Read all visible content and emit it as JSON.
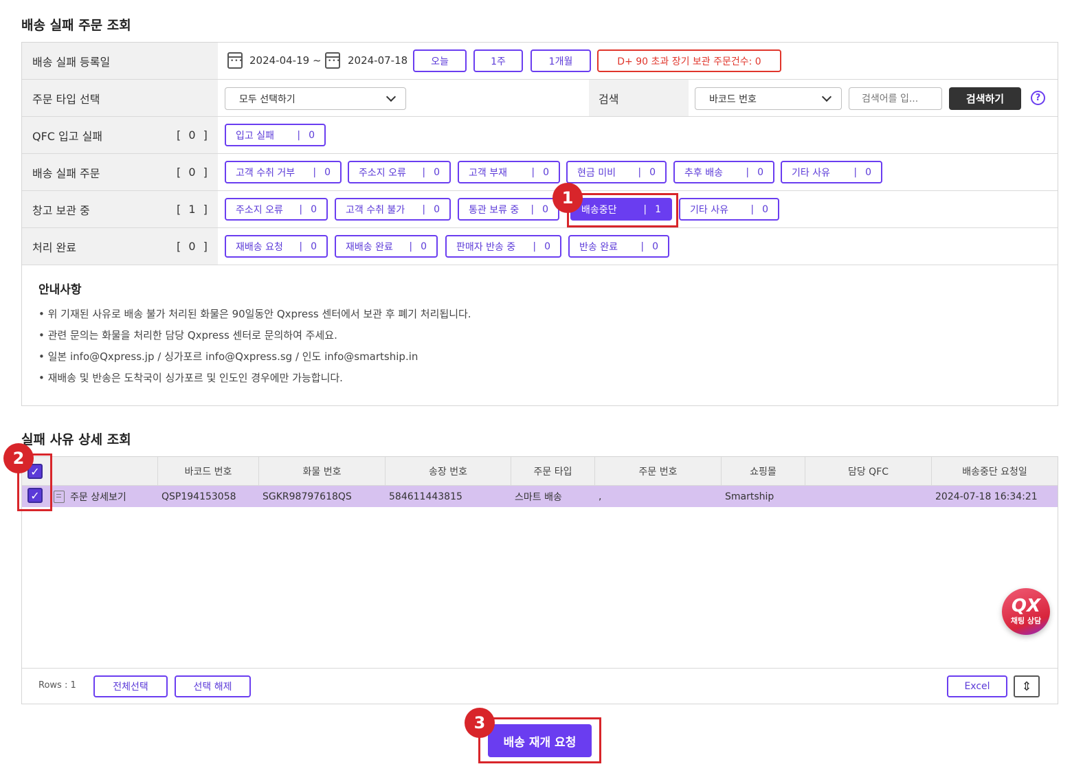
{
  "sections": {
    "search_title": "배송 실패 주문 조회",
    "detail_title": "실패 사유 상세 조회"
  },
  "filters": {
    "date": {
      "label": "배송 실패 등록일",
      "start": "2024-04-19 ~",
      "end": "2024-07-18",
      "quick": [
        "오늘",
        "1주",
        "1개월"
      ],
      "long_term": "D+ 90 초과 장기 보관 주문건수: 0"
    },
    "order_type": {
      "label": "주문 타입 선택",
      "selected": "모두 선택하기",
      "search_label": "검색",
      "search_field": "바코드 번호",
      "search_placeholder": "검색어를 입...",
      "search_button": "검색하기",
      "help": "?"
    },
    "qfc": {
      "label": "QFC 입고 실패",
      "count": "[ 0 ]",
      "buttons": [
        {
          "label": "입고 실패",
          "count": "0"
        }
      ]
    },
    "failed": {
      "label": "배송 실패 주문",
      "count": "[ 0 ]",
      "buttons": [
        {
          "label": "고객 수취 거부",
          "count": "0"
        },
        {
          "label": "주소지 오류",
          "count": "0"
        },
        {
          "label": "고객 부재",
          "count": "0"
        },
        {
          "label": "현금 미비",
          "count": "0"
        },
        {
          "label": "추후 배송",
          "count": "0"
        },
        {
          "label": "기타 사유",
          "count": "0"
        }
      ]
    },
    "warehouse": {
      "label": "창고 보관 중",
      "count": "[ 1 ]",
      "buttons": [
        {
          "label": "주소지 오류",
          "count": "0"
        },
        {
          "label": "고객 수취 불가",
          "count": "0"
        },
        {
          "label": "통관 보류 중",
          "count": "0"
        },
        {
          "label": "배송중단",
          "count": "1"
        },
        {
          "label": "기타 사유",
          "count": "0"
        }
      ]
    },
    "done": {
      "label": "처리 완료",
      "count": "[ 0 ]",
      "buttons": [
        {
          "label": "재배송 요청",
          "count": "0"
        },
        {
          "label": "재배송 완료",
          "count": "0"
        },
        {
          "label": "판매자 반송 중",
          "count": "0"
        },
        {
          "label": "반송 완료",
          "count": "0"
        }
      ]
    }
  },
  "notice": {
    "title": "안내사항",
    "lines": [
      "• 위 기재된 사유로 배송 불가 처리된 화물은 90일동안 Qxpress 센터에서 보관 후 폐기 처리됩니다.",
      "• 관련 문의는 화물을 처리한 담당 Qxpress 센터로 문의하여 주세요.",
      "• 일본 info@Qxpress.jp / 싱가포르 info@Qxpress.sg / 인도 info@smartship.in",
      "• 재배송 및 반송은 도착국이 싱가포르 및 인도인 경우에만 가능합니다."
    ]
  },
  "grid": {
    "columns": [
      "바코드 번호",
      "화물 번호",
      "송장 번호",
      "주문 타입",
      "주문 번호",
      "쇼핑몰",
      "담당 QFC",
      "배송중단 요청일"
    ],
    "rows": [
      {
        "detail": "주문 상세보기",
        "cells": [
          "QSP194153058",
          "SGKR98797618QS",
          "584611443815",
          "스마트 배송",
          ",",
          "Smartship",
          "",
          "2024-07-18 16:34:21"
        ]
      }
    ],
    "rows_label": "Rows : 1",
    "select_all": "전체선택",
    "deselect": "선택 해제",
    "excel": "Excel"
  },
  "action": {
    "resume": "배송 재개 요청"
  },
  "markers": [
    "1",
    "2",
    "3"
  ],
  "chat": {
    "logo": "QX",
    "label": "채팅 상담"
  },
  "colors": {
    "accent": "#6a3df0",
    "highlight": "#d8252a",
    "selected_row": "#d7c2f0"
  }
}
